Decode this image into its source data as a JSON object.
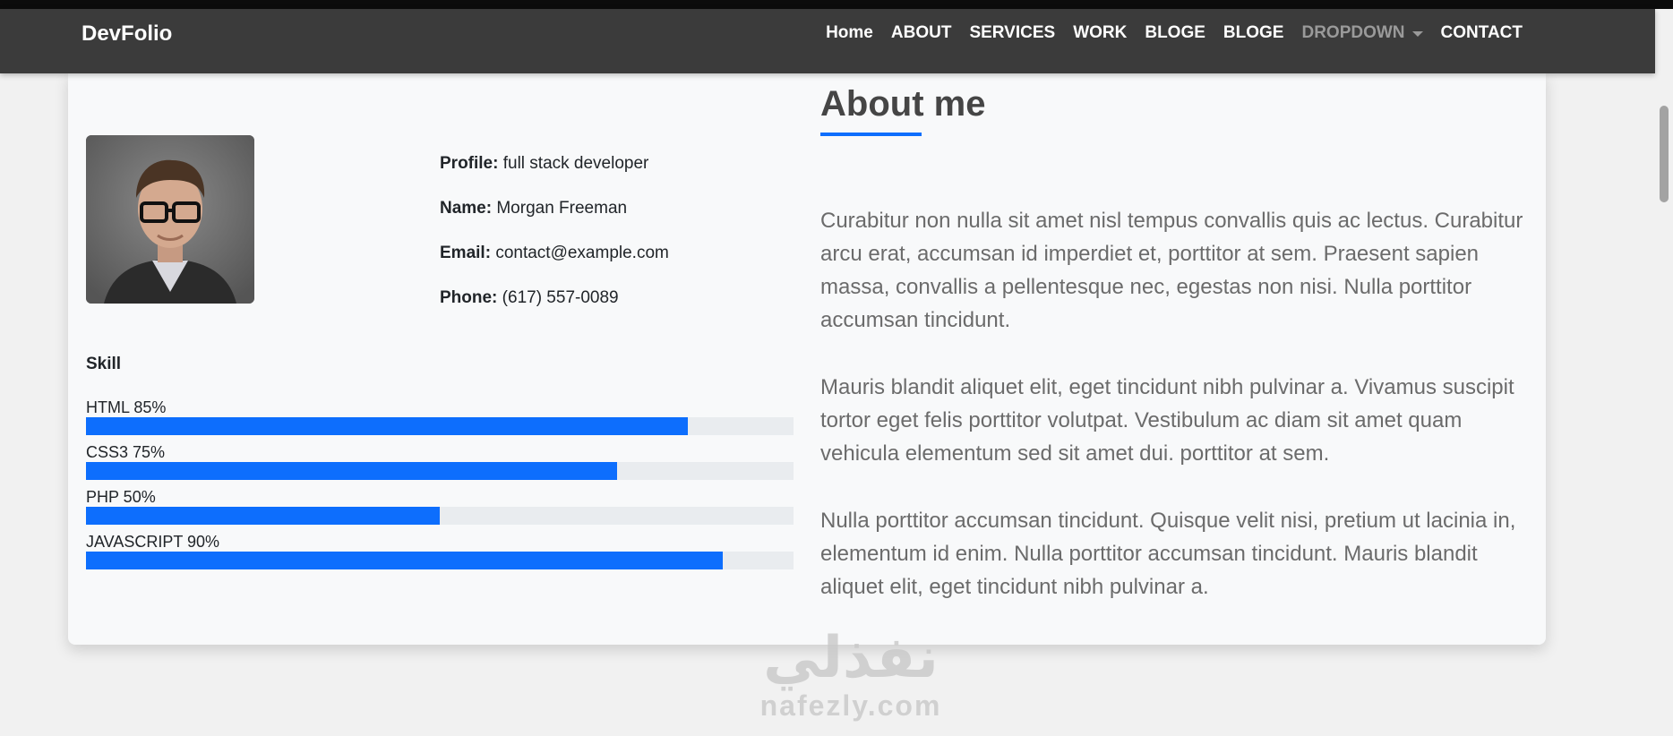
{
  "brand": "DevFolio",
  "nav": {
    "items": [
      "Home",
      "ABOUT",
      "SERVICES",
      "WORK",
      "BLOGE",
      "BLOGE"
    ],
    "dropdown": "DROPDOWN",
    "contact": "CONTACT"
  },
  "profile": {
    "rows": [
      {
        "label": "Profile:",
        "value": "full stack developer"
      },
      {
        "label": "Name:",
        "value": "Morgan Freeman"
      },
      {
        "label": "Email:",
        "value": "contact@example.com"
      },
      {
        "label": "Phone:",
        "value": "(617) 557-0089"
      }
    ]
  },
  "skills": {
    "title": "Skill",
    "items": [
      {
        "label": "HTML 85%",
        "percent": 85
      },
      {
        "label": "CSS3 75%",
        "percent": 75
      },
      {
        "label": "PHP 50%",
        "percent": 50
      },
      {
        "label": "JAVASCRIPT 90%",
        "percent": 90
      }
    ]
  },
  "about": {
    "title": "About me",
    "paragraphs": [
      "Curabitur non nulla sit amet nisl tempus convallis quis ac lectus. Curabitur arcu erat, accumsan id imperdiet et, porttitor at sem. Praesent sapien massa, convallis a pellentesque nec, egestas non nisi. Nulla porttitor accumsan tincidunt.",
      "Mauris blandit aliquet elit, eget tincidunt nibh pulvinar a. Vivamus suscipit tortor eget felis porttitor volutpat. Vestibulum ac diam sit amet quam vehicula elementum sed sit amet dui. porttitor at sem.",
      "Nulla porttitor accumsan tincidunt. Quisque velit nisi, pretium ut lacinia in, elementum id enim. Nulla porttitor accumsan tincidunt. Mauris blandit aliquet elit, eget tincidunt nibh pulvinar a."
    ]
  },
  "watermark": {
    "arabic": "نفذلي",
    "latin": "nafezly.com"
  },
  "colors": {
    "navbar": "#3b3b3b",
    "accent": "#0d6efd",
    "card": "#f8f9fa",
    "page": "#f1f1f1"
  }
}
